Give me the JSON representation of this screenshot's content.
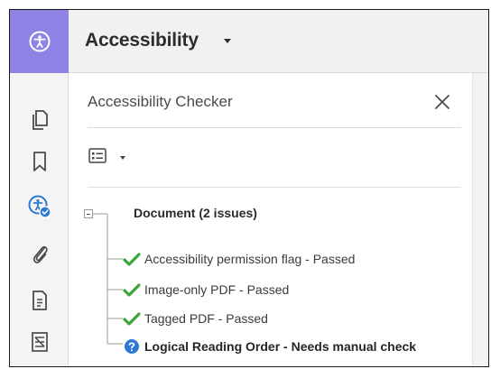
{
  "header": {
    "title": "Accessibility"
  },
  "panel": {
    "title": "Accessibility Checker",
    "tree": {
      "root_label": "Document (2 issues)",
      "items": [
        {
          "label": "Accessibility permission flag - Passed",
          "status": "passed",
          "icon": "checkmark-icon"
        },
        {
          "label": "Image-only PDF - Passed",
          "status": "passed",
          "icon": "checkmark-icon"
        },
        {
          "label": "Tagged PDF - Passed",
          "status": "passed",
          "icon": "checkmark-icon"
        },
        {
          "label": "Logical Reading Order - Needs manual check",
          "status": "manual",
          "icon": "question-icon"
        }
      ]
    }
  },
  "rail": {
    "icons": [
      "accessibility-icon",
      "pages-icon",
      "bookmark-icon",
      "accessibility-check-icon",
      "attachment-icon",
      "document-properties-icon",
      "content-icon"
    ]
  },
  "colors": {
    "accent": "#8f84e6",
    "passed": "#3aa63a",
    "manual": "#2c78d4",
    "rail_icon": "#4a4a4a"
  }
}
